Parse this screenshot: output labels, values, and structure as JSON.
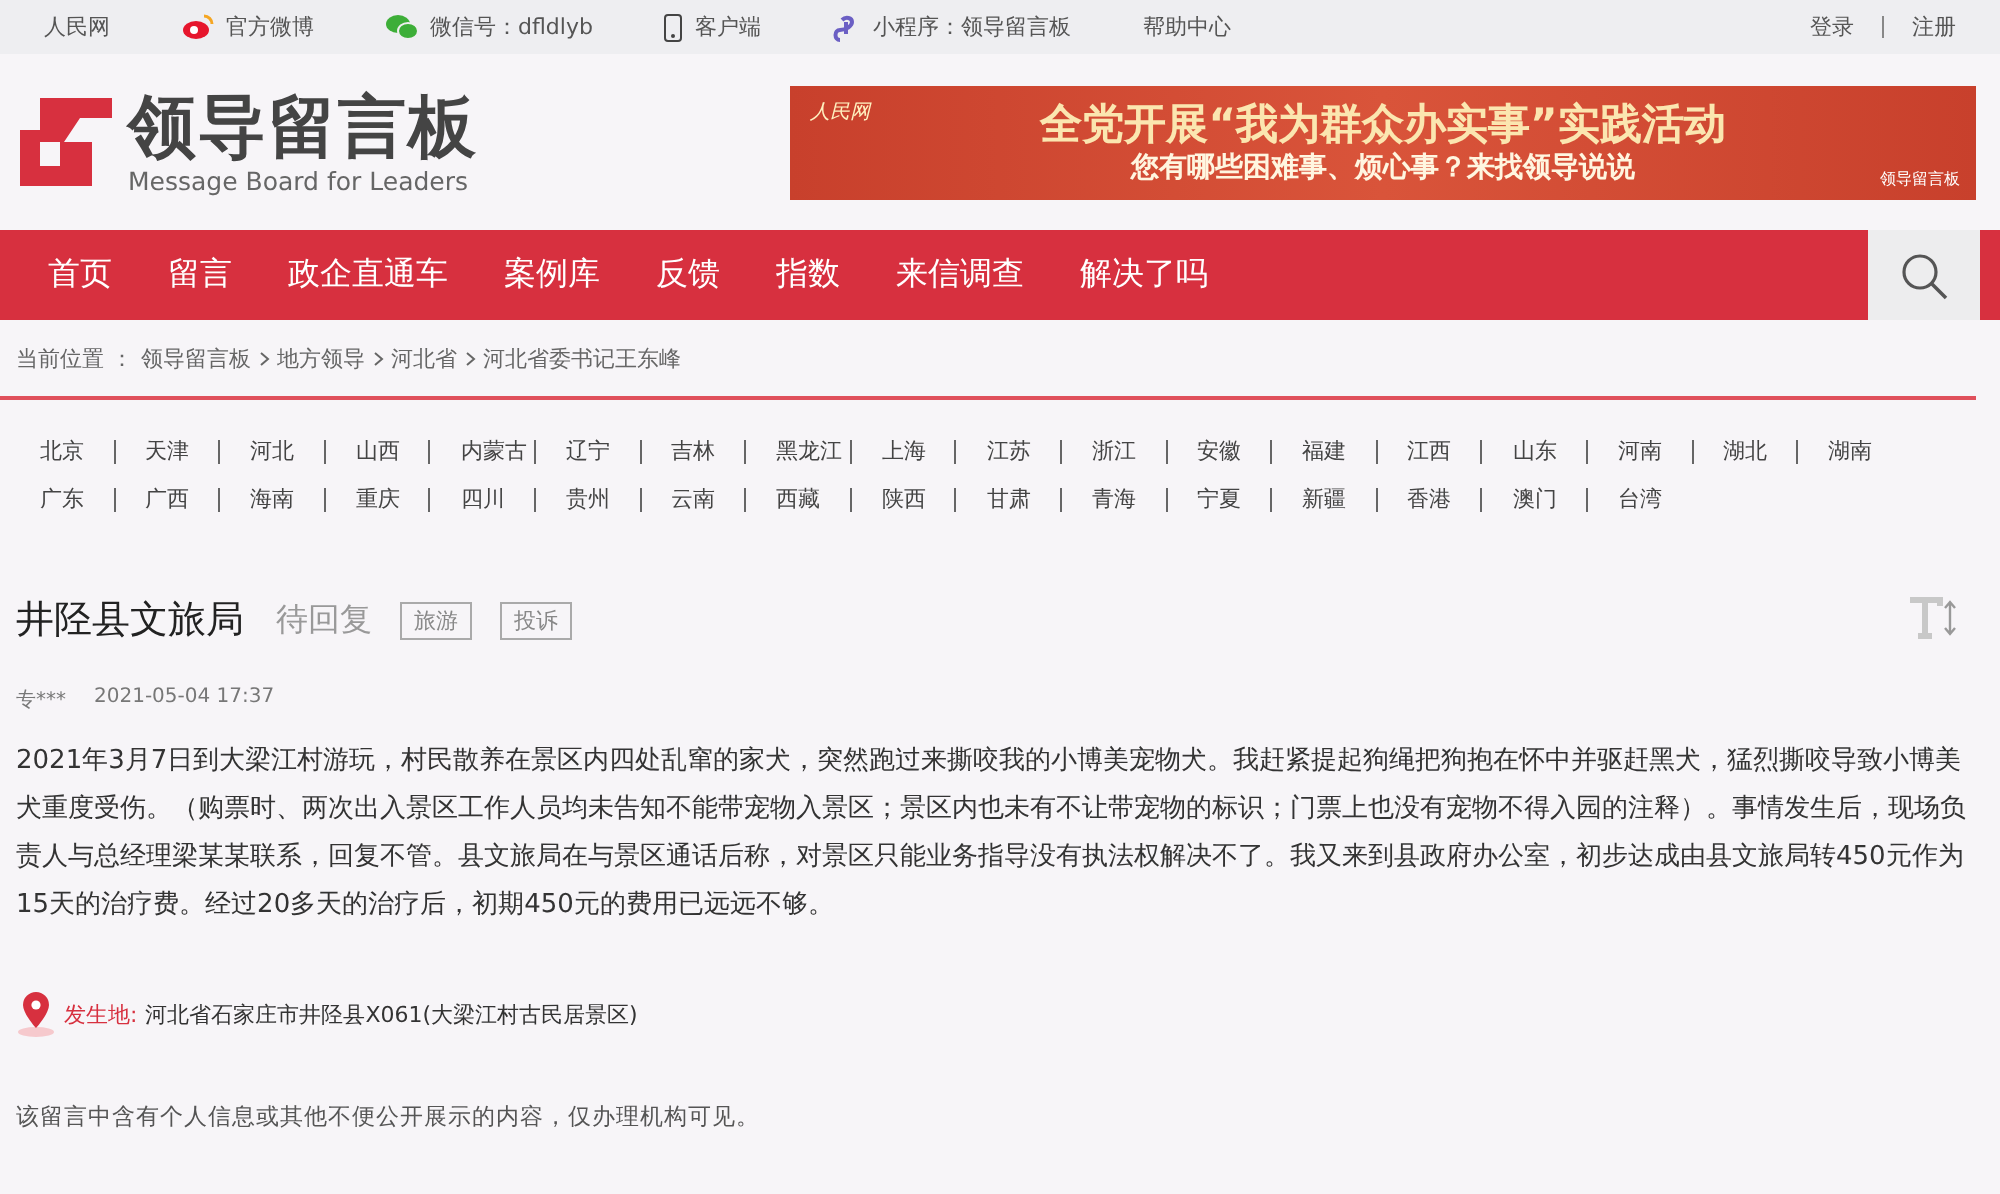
{
  "top_bar": {
    "links": [
      {
        "kind": "text",
        "label": "人民网"
      },
      {
        "kind": "weibo",
        "label": "官方微博"
      },
      {
        "kind": "wechat",
        "label": "微信号：dfldlyb"
      },
      {
        "kind": "phone",
        "label": "客户端"
      },
      {
        "kind": "mini",
        "label": "小程序：领导留言板"
      },
      {
        "kind": "text",
        "label": "帮助中心"
      }
    ],
    "account": [
      "登录",
      "注册"
    ]
  },
  "logo": {
    "title": "领导留言板",
    "subtitle": "Message Board for Leaders"
  },
  "banner": {
    "source": "人民网",
    "title": "全党开展“我为群众办实事”实践活动",
    "subtitle": "您有哪些困难事、烦心事？来找领导说说",
    "badge": "领导留言板"
  },
  "nav": {
    "items": [
      {
        "label": "首页",
        "selected": false
      },
      {
        "label": "留言",
        "selected": false
      },
      {
        "label": "政企直通车",
        "selected": false
      },
      {
        "label": "案例库",
        "selected": false
      },
      {
        "label": "反馈",
        "selected": false
      },
      {
        "label": "指数",
        "selected": false
      },
      {
        "label": "来信调查",
        "selected": false
      },
      {
        "label": "解决了吗",
        "selected": false
      }
    ]
  },
  "breadcrumb": {
    "label": "当前位置 ：",
    "items": [
      "领导留言板",
      "地方领导",
      "河北省",
      "河北省委书记王东峰"
    ]
  },
  "provinces": [
    [
      "北京",
      "天津",
      "河北",
      "山西",
      "内蒙古",
      "辽宁",
      "吉林",
      "黑龙江",
      "上海",
      "江苏",
      "浙江",
      "安徽",
      "福建",
      "江西",
      "山东",
      "河南",
      "湖北",
      "湖南"
    ],
    [
      "广东",
      "广西",
      "海南",
      "重庆",
      "四川",
      "贵州",
      "云南",
      "西藏",
      "陕西",
      "甘肃",
      "青海",
      "宁夏",
      "新疆",
      "香港",
      "澳门",
      "台湾"
    ]
  ],
  "message": {
    "title": "井陉县文旅局",
    "status": "待回复",
    "tags": [
      "旅游",
      "投诉"
    ],
    "author": "专***",
    "time": "2021-05-04 17:37",
    "body": "2021年3月7日到大梁江村游玩，村民散养在景区内四处乱窜的家犬，突然跑过来撕咬我的小博美宠物犬。我赶紧提起狗绳把狗抱在怀中并驱赶黑犬，猛烈撕咬导致小博美犬重度受伤。（购票时、两次出入景区工作人员均未告知不能带宠物入景区；景区内也未有不让带宠物的标识；门票上也没有宠物不得入园的注释）。事情发生后，现场负责人与总经理梁某某联系，回复不管。县文旅局在与景区通话后称，对景区只能业务指导没有执法权解决不了。我又来到县政府办公室，初步达成由县文旅局转450元作为15天的治疗费。经过20多天的治疗后，初期450元的费用已远远不够。",
    "location_label": "发生地:",
    "location": "河北省石家庄市井陉县X061(大梁江村古民居景区)",
    "notice": "该留言中含有个人信息或其他不便公开展示的内容，仅办理机构可见。"
  }
}
